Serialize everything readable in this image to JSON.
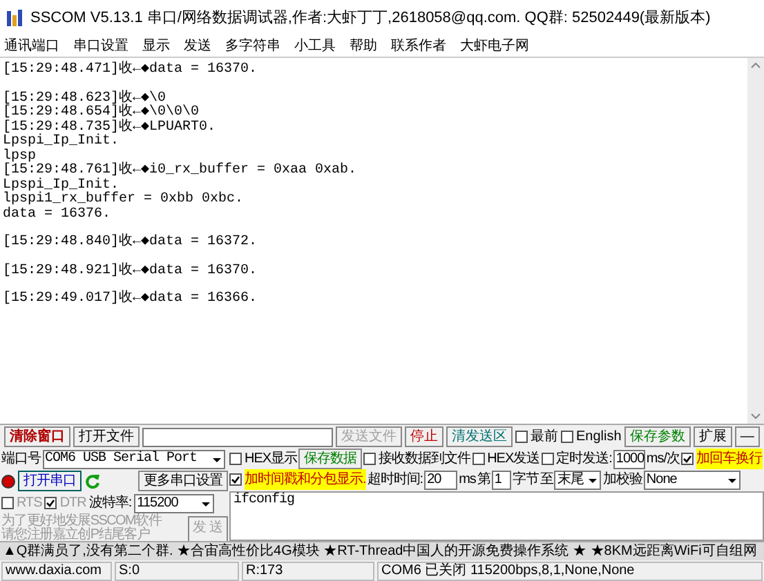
{
  "window": {
    "title": "SSCOM V5.13.1 串口/网络数据调试器,作者:大虾丁丁,2618058@qq.com. QQ群: 52502449(最新版本)"
  },
  "menu": [
    "通讯端口",
    "串口设置",
    "显示",
    "发送",
    "多字符串",
    "小工具",
    "帮助",
    "联系作者",
    "大虾电子网"
  ],
  "log": [
    [
      "[15:29:48.471]收←◆data = 16370."
    ],
    [
      "[15:29:48.623]收←◆\\0",
      "[15:29:48.654]收←◆\\0\\0\\0",
      "[15:29:48.735]收←◆LPUART0.",
      "Lpspi_Ip_Init.",
      "lpsp",
      "[15:29:48.761]收←◆i0_rx_buffer = 0xaa 0xab.",
      "Lpspi_Ip_Init.",
      "lpspi1_rx_buffer = 0xbb 0xbc.",
      "data = 16376."
    ],
    [
      "[15:29:48.840]收←◆data = 16372."
    ],
    [
      "[15:29:48.921]收←◆data = 16370."
    ],
    [
      "[15:29:49.017]收←◆data = 16366."
    ]
  ],
  "toolbar": {
    "clear": "清除窗口",
    "open_file": "打开文件",
    "send_file": {
      "label": "发送文件",
      "disabled": true
    },
    "stop": "停止",
    "clear_send": "清发送区",
    "topmost": {
      "label": "最前",
      "checked": false
    },
    "english": {
      "label": "English",
      "checked": false
    },
    "save_params": "保存参数",
    "expand": "扩展",
    "collapse": "—"
  },
  "port": {
    "label": "端口号",
    "value": "COM6 USB Serial Port",
    "open": false,
    "open_button": "打开串口",
    "more": "更多串口设置",
    "rts": {
      "label": "RTS",
      "checked": false
    },
    "dtr": {
      "label": "DTR",
      "checked": true
    },
    "baud_label": "波特率:",
    "baud": "115200",
    "note": [
      "为了更好地发展SSCOM软件",
      "请您注册嘉立创P结尾客户"
    ],
    "send": {
      "label": "发 送",
      "disabled": true
    }
  },
  "options1": {
    "hex_show": {
      "label": "HEX显示",
      "checked": false
    },
    "save_data": "保存数据",
    "recv_file": {
      "label": "接收数据到文件",
      "checked": false
    },
    "hex_send": {
      "label": "HEX发送",
      "checked": false
    },
    "timed": {
      "label": "定时发送:",
      "checked": false
    },
    "interval": "1000",
    "interval_unit": "ms/次",
    "crlf": {
      "label": "加回车换行",
      "checked": true
    }
  },
  "options2": {
    "timestamp": {
      "label": "加时间戳和分包显示.",
      "checked": true
    },
    "timeout_label": "超时时间:",
    "timeout": "20",
    "timeout_unit": "ms",
    "byte_from_label": "第",
    "byte_from": "1",
    "byte_unit": "字节",
    "to_label": "至",
    "to": "末尾",
    "checksum_label": "加校验",
    "checksum": "None"
  },
  "send_text": "ifconfig",
  "ticker": "▲Q群满员了,没有第二个群. ★合宙高性价比4G模块 ★RT-Thread中国人的开源免费操作系统 ★ ★8KM远距离WiFi可自组网",
  "status": [
    "www.daxia.com",
    "S:0",
    "R:173",
    "COM6 已关闭  115200bps,8,1,None,None"
  ]
}
